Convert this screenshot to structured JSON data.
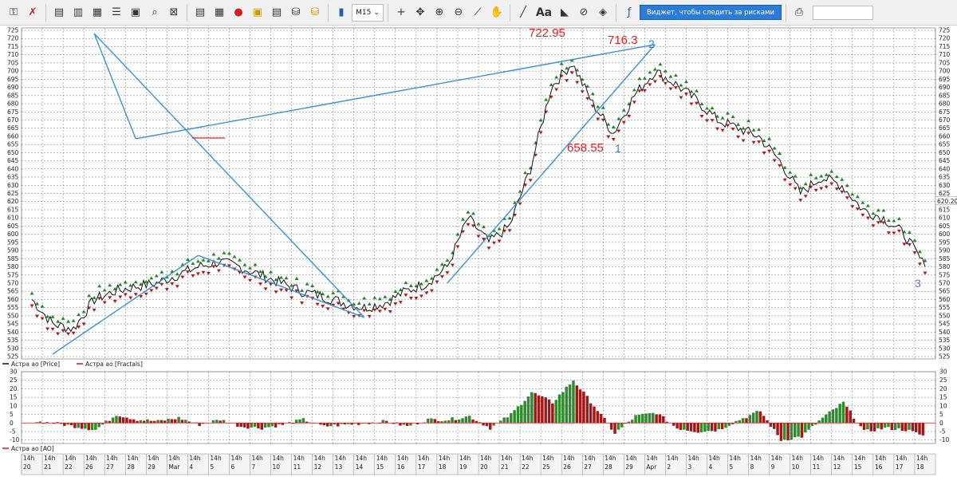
{
  "toolbar": {
    "timeframe": "M15",
    "font_label": "Aa",
    "widget_button": "Виджет, чтобы следить за рисками",
    "icons": [
      "key-icon",
      "delete-chart-icon",
      "new-chart-icon",
      "chart-window-icon",
      "chart-window2-icon",
      "list-icon",
      "calc-icon",
      "zoom-doc-icon",
      "close-doc-icon",
      "report-icon",
      "calendar-icon",
      "alert-icon",
      "stack-icon",
      "stack2-icon",
      "db-icon",
      "db2-icon",
      "bar-chart-icon",
      "crosshair-icon",
      "move-icon",
      "zoom-in-icon",
      "zoom-out-icon",
      "ruler-icon",
      "hand-icon",
      "line-tool-icon",
      "text-tool-icon",
      "fill-icon",
      "hide-icon",
      "layers-icon",
      "info-icon",
      "print-preview-icon"
    ]
  },
  "price_axis": {
    "ticks": [
      "725",
      "720",
      "715",
      "710",
      "705",
      "700",
      "695",
      "690",
      "685",
      "680",
      "675",
      "670",
      "665",
      "660",
      "655",
      "650",
      "645",
      "640",
      "635",
      "630",
      "625",
      "620",
      "615",
      "610",
      "605",
      "600",
      "595",
      "590",
      "585",
      "580",
      "575",
      "570",
      "565",
      "560",
      "555",
      "550",
      "545",
      "540",
      "535",
      "530",
      "525"
    ],
    "current_price": "620.20"
  },
  "annotations": {
    "high1": "722.95",
    "high2": "716.3",
    "low1": "658.55",
    "wave1": "1",
    "wave2": "2",
    "wave3": "3"
  },
  "legend": {
    "price": "Астра ао [Price]",
    "fractals": "Астра ао [Fractals]",
    "ao": "Астра ао [AO]"
  },
  "ao_axis": {
    "ticks": [
      "30",
      "25",
      "20",
      "15",
      "10",
      "5",
      "0",
      "-5",
      "-10"
    ]
  },
  "date_axis": {
    "hour_label": "14h",
    "dates": [
      "20",
      "21",
      "22",
      "26",
      "27",
      "28",
      "29",
      "Mar",
      "4",
      "5",
      "6",
      "7",
      "10",
      "11",
      "12",
      "13",
      "14",
      "15",
      "16",
      "17",
      "18",
      "19",
      "20",
      "21",
      "22",
      "25",
      "26",
      "27",
      "28",
      "29",
      "Apr",
      "2",
      "3",
      "4",
      "5",
      "8",
      "9",
      "10",
      "11",
      "12",
      "15",
      "16",
      "17",
      "18"
    ]
  },
  "colors": {
    "trendline": "#3a8fd6",
    "fractal_up": "#1b8a1b",
    "fractal_down": "#b01818",
    "price": "#111111",
    "ao_up": "#2e8b2e",
    "ao_down": "#a01818",
    "annotation": "#e02020",
    "widget": "#2d7bd6"
  },
  "chart_data": {
    "type": "line",
    "title": "",
    "xlabel": "",
    "ylabel": "",
    "ylim": [
      525,
      725
    ],
    "x": [
      "20",
      "21",
      "22",
      "26",
      "27",
      "28",
      "29",
      "Mar",
      "4",
      "5",
      "6",
      "7",
      "10",
      "11",
      "12",
      "13",
      "14",
      "15",
      "16",
      "17",
      "18",
      "19",
      "20",
      "21",
      "22",
      "25",
      "26",
      "27",
      "28",
      "29",
      "Apr",
      "2",
      "3",
      "4",
      "5",
      "8",
      "9",
      "10",
      "11",
      "12",
      "15",
      "16",
      "17",
      "18"
    ],
    "series": [
      {
        "values": [
          560,
          545,
          542,
          560,
          565,
          568,
          570,
          575,
          580,
          583,
          580,
          575,
          570,
          565,
          562,
          558,
          555,
          558,
          565,
          570,
          580,
          610,
          595,
          605,
          640,
          690,
          705,
          680,
          662,
          685,
          700,
          692,
          682,
          670,
          665,
          660,
          645,
          625,
          635,
          630,
          615,
          610,
          600,
          580
        ]
      }
    ],
    "trendlines": [
      {
        "from": [
          "21",
          526.5
        ],
        "to": [
          "4",
          587
        ]
      },
      {
        "from": [
          "4",
          587
        ],
        "to": [
          "14",
          549
        ]
      },
      {
        "from": [
          "14",
          549
        ],
        "to": [
          "26",
          723
        ]
      },
      {
        "from": [
          "26",
          723
        ],
        "to": [
          "28",
          658.5
        ]
      },
      {
        "from": [
          "28",
          658.5
        ],
        "to": [
          "Apr",
          716.3
        ]
      },
      {
        "from": [
          "Apr",
          716.3
        ],
        "to": [
          "18",
          570
        ]
      }
    ],
    "horizontal_line": {
      "value": 659,
      "from": "4",
      "to": "5"
    },
    "ao_ylim": [
      -12,
      30
    ],
    "ao_values": [
      1,
      0,
      -2,
      -4,
      5,
      2,
      1,
      3,
      -1,
      2,
      -2,
      -3,
      -1,
      2,
      -2,
      -1,
      0,
      1,
      -2,
      2,
      2,
      4,
      -3,
      5,
      18,
      12,
      25,
      10,
      -6,
      4,
      6,
      -3,
      -5,
      -4,
      2,
      7,
      -10,
      -8,
      3,
      12,
      -5,
      -3,
      -4,
      -8
    ]
  }
}
